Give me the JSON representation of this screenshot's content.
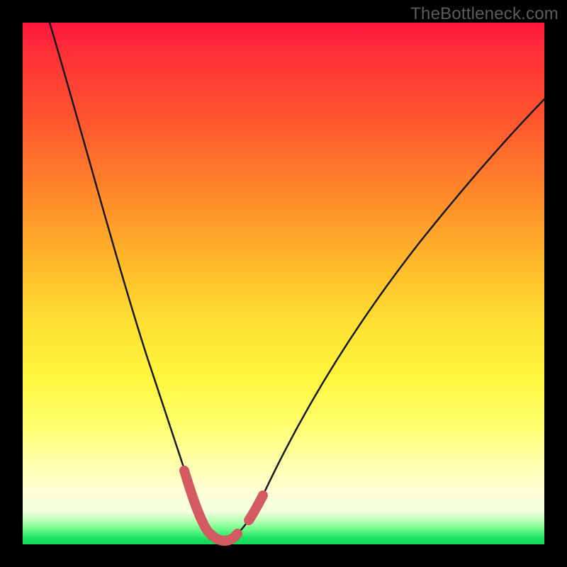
{
  "watermark": "TheBottleneck.com",
  "colors": {
    "frame": "#000000",
    "curve_stroke": "#171717",
    "highlight_stroke": "#d45a62"
  },
  "chart_data": {
    "type": "line",
    "title": "",
    "xlabel": "",
    "ylabel": "",
    "xlim": [
      0,
      100
    ],
    "ylim": [
      0,
      100
    ],
    "series": [
      {
        "name": "bottleneck-curve",
        "x": [
          4,
          8,
          12,
          16,
          20,
          24,
          28,
          30,
          32,
          34,
          35,
          36,
          37,
          38,
          39,
          40,
          42,
          44,
          48,
          56,
          64,
          72,
          80,
          88,
          96,
          100
        ],
        "y": [
          100,
          86,
          73,
          61,
          49,
          37,
          24,
          17,
          10,
          5,
          3,
          1.5,
          0.8,
          0.5,
          0.5,
          0.8,
          1.8,
          4,
          10,
          24,
          36,
          47,
          56,
          64,
          71,
          74
        ]
      }
    ],
    "highlight_ranges_x": [
      [
        30,
        39
      ],
      [
        41.5,
        44
      ]
    ]
  }
}
